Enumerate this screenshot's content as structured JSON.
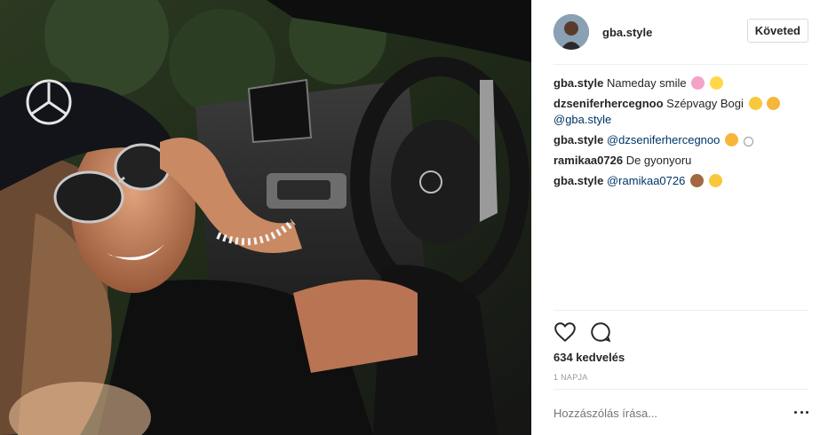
{
  "post": {
    "username": "gba.style",
    "follow_label": "Követed"
  },
  "comments": [
    {
      "author": "gba.style",
      "text": "Nameday smile",
      "emojis": [
        "hibiscus-emoji",
        "sparkles-emoji"
      ]
    },
    {
      "author": "dzseniferhercegnoo",
      "text": "Szépvagy Bogi",
      "emojis": [
        "smile-emoji",
        "kiss-emoji"
      ],
      "mention": "@gba.style"
    },
    {
      "author": "gba.style",
      "mention": "@dzseniferhercegnoo",
      "emojis": [
        "kiss-emoji",
        "smiley-emoji"
      ]
    },
    {
      "author": "ramikaa0726",
      "text": "De gyonyoru"
    },
    {
      "author": "gba.style",
      "mention": "@ramikaa0726",
      "emojis": [
        "see-no-evil-monkey-emoji",
        "cat-emoji"
      ]
    }
  ],
  "likes_text": "634 kedvelés",
  "time_text": "1 NAPJA",
  "comment_placeholder": "Hozzászólás írása...",
  "colors": {
    "mention": "#003569",
    "border": "#efefef",
    "muted": "#999999"
  }
}
